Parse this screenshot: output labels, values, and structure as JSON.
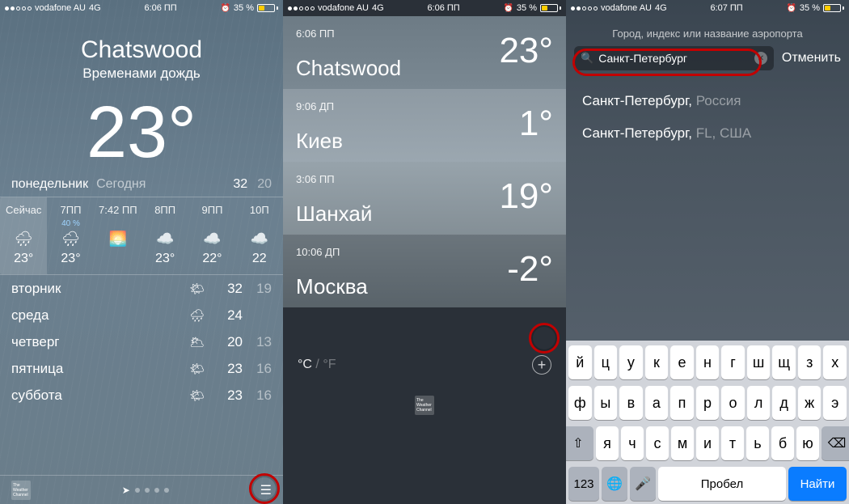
{
  "status": {
    "carrier": "vodafone AU",
    "network": "4G",
    "time1": "6:06 ПП",
    "time2": "6:06 ПП",
    "time3": "6:07 ПП",
    "battery_pct": "35 %"
  },
  "screen1": {
    "city": "Chatswood",
    "condition": "Временами дождь",
    "temp": "23°",
    "today_day": "понедельник",
    "today_label": "Сегодня",
    "today_hi": "32",
    "today_lo": "20",
    "hourly": [
      {
        "time": "Сейчас",
        "pct": "",
        "icon": "🌧",
        "temp": "23°"
      },
      {
        "time": "7ПП",
        "pct": "40 %",
        "icon": "🌧",
        "temp": "23°"
      },
      {
        "time": "7:42 ПП",
        "pct": "",
        "icon": "🌅",
        "temp": ""
      },
      {
        "time": "8ПП",
        "pct": "",
        "icon": "☁️",
        "temp": "23°"
      },
      {
        "time": "9ПП",
        "pct": "",
        "icon": "☁️",
        "temp": "22°"
      },
      {
        "time": "10П",
        "pct": "",
        "icon": "☁️",
        "temp": "22"
      }
    ],
    "daily": [
      {
        "day": "вторник",
        "icon": "🌤",
        "hi": "32",
        "lo": "19"
      },
      {
        "day": "среда",
        "icon": "🌧",
        "hi": "24",
        "lo": ""
      },
      {
        "day": "четверг",
        "icon": "🌥",
        "hi": "20",
        "lo": "13"
      },
      {
        "day": "пятница",
        "icon": "🌤",
        "hi": "23",
        "lo": "16"
      },
      {
        "day": "суббота",
        "icon": "🌤",
        "hi": "23",
        "lo": "16"
      }
    ],
    "twc": "The Weather Channel",
    "list_icon": "☰"
  },
  "screen2": {
    "cities": [
      {
        "time": "6:06 ПП",
        "name": "Chatswood",
        "temp": "23°"
      },
      {
        "time": "9:06 ДП",
        "name": "Киев",
        "temp": "1°"
      },
      {
        "time": "3:06 ПП",
        "name": "Шанхай",
        "temp": "19°"
      },
      {
        "time": "10:06 ДП",
        "name": "Москва",
        "temp": "-2°"
      }
    ],
    "unit_c": "°C",
    "unit_sep": "/",
    "unit_f": "°F",
    "plus": "+",
    "twc": "The Weather Channel"
  },
  "screen3": {
    "prompt": "Город, индекс или название аэропорта",
    "search_value": "Санкт-Петербург",
    "cancel": "Отменить",
    "results": [
      {
        "main": "Санкт-Петербург, ",
        "sub": "Россия"
      },
      {
        "main": "Санкт-Петербург, ",
        "sub": "FL, США"
      }
    ],
    "keyboard": {
      "row1": [
        "й",
        "ц",
        "у",
        "к",
        "е",
        "н",
        "г",
        "ш",
        "щ",
        "з",
        "х"
      ],
      "row2": [
        "ф",
        "ы",
        "в",
        "а",
        "п",
        "р",
        "о",
        "л",
        "д",
        "ж",
        "э"
      ],
      "row3_shift": "⇧",
      "row3": [
        "я",
        "ч",
        "с",
        "м",
        "и",
        "т",
        "ь",
        "б",
        "ю"
      ],
      "row3_bksp": "⌫",
      "num": "123",
      "globe": "🌐",
      "mic": "🎤",
      "space": "Пробел",
      "return": "Найти"
    }
  }
}
